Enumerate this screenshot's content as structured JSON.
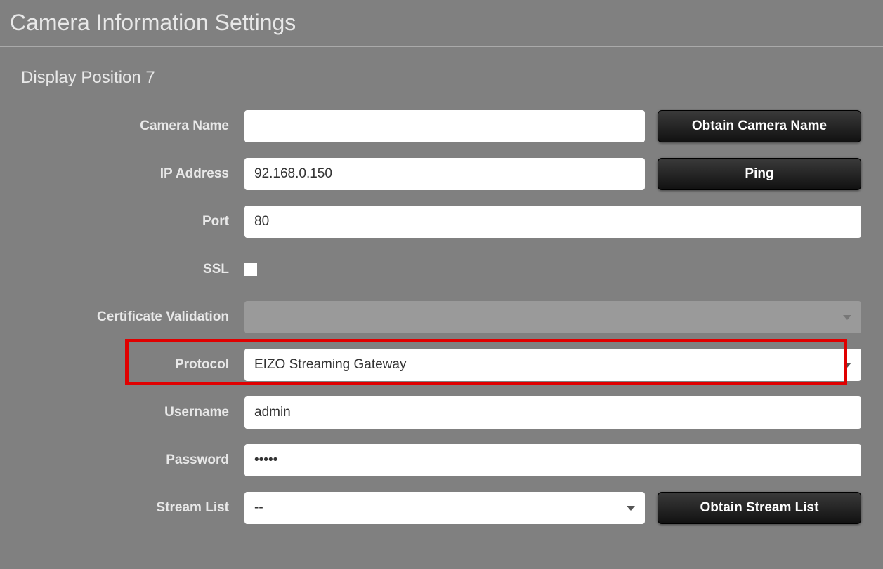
{
  "header": {
    "title": "Camera Information Settings"
  },
  "section": {
    "title": "Display Position 7"
  },
  "fields": {
    "camera_name_label": "Camera Name",
    "camera_name_value": "",
    "obtain_camera_name_btn": "Obtain Camera Name",
    "ip_address_label": "IP Address",
    "ip_address_value": "92.168.0.150",
    "ping_btn": "Ping",
    "port_label": "Port",
    "port_value": "80",
    "ssl_label": "SSL",
    "ssl_checked": false,
    "cert_validation_label": "Certificate Validation",
    "cert_validation_value": "",
    "protocol_label": "Protocol",
    "protocol_value": "EIZO Streaming Gateway",
    "username_label": "Username",
    "username_value": "admin",
    "password_label": "Password",
    "password_value": "•••••",
    "stream_list_label": "Stream List",
    "stream_list_value": "--",
    "obtain_stream_list_btn": "Obtain Stream List"
  }
}
